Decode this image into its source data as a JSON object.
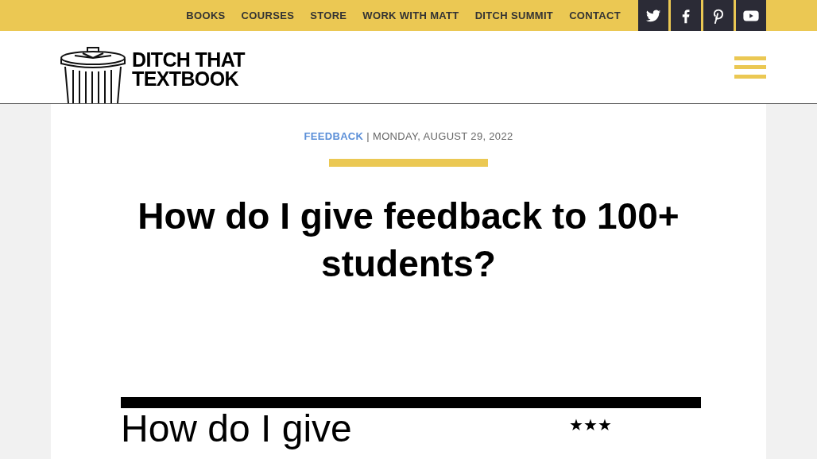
{
  "top_nav": {
    "links": [
      "BOOKS",
      "COURSES",
      "STORE",
      "WORK WITH MATT",
      "DITCH SUMMIT",
      "CONTACT"
    ],
    "social": [
      {
        "kind": "twitter"
      },
      {
        "kind": "facebook"
      },
      {
        "kind": "pinterest"
      },
      {
        "kind": "youtube"
      }
    ]
  },
  "logo": {
    "lines": [
      "DITCH THAT",
      "TEXTBOOK"
    ]
  },
  "post": {
    "category": "FEEDBACK",
    "separator": "|",
    "date": "MONDAY, AUGUST 29, 2022",
    "title": "How do I give feedback to 100+ students?",
    "image": {
      "heading": "How do I give",
      "stars": "★★★"
    }
  }
}
